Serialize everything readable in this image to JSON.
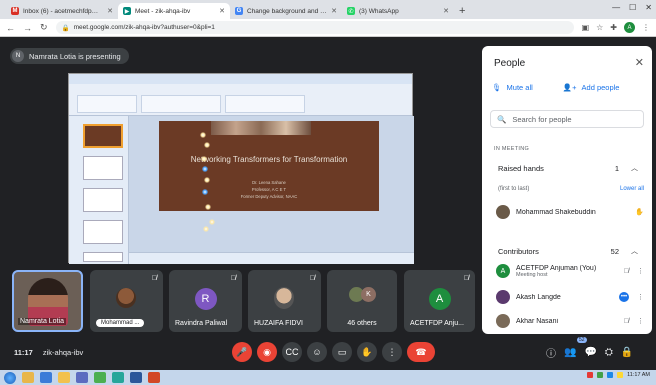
{
  "browser": {
    "tabs": [
      {
        "title": "Inbox (6) - acetmechfdp@gmail...",
        "fav": "M",
        "color": "#d93025",
        "active": false
      },
      {
        "title": "Meet - zik-ahqa-ibv",
        "fav": "▶",
        "color": "#00897b",
        "active": true
      },
      {
        "title": "Change background and apply vis...",
        "fav": "G",
        "color": "#4285f4",
        "active": false
      },
      {
        "title": "(3) WhatsApp",
        "fav": "✆",
        "color": "#25d366",
        "active": false
      }
    ],
    "url": "meet.google.com/zik-ahqa-ibv?authuser=0&pli=1",
    "profile_initial": "A"
  },
  "meet": {
    "presenter_banner": "Namrata Lotia is presenting",
    "presenter_initial": "N",
    "slide": {
      "title": "Networking Transformers for Transformation",
      "lines": [
        "Dr. Leena Sahane",
        "Professor, A C E T",
        "Former Deputy Advisor, NAAC"
      ]
    },
    "tiles": [
      {
        "name": "Namrata Lotia"
      },
      {
        "name": "Mohammad ..."
      },
      {
        "name": "Ravindra Paliwal",
        "initial": "R",
        "color": "#7e57c2"
      },
      {
        "name": "HUZAIFA FIDVI"
      },
      {
        "name": "46 others",
        "initial": "K",
        "color": "#8d6e63"
      },
      {
        "name": "ACETFDP Anju...",
        "initial": "A",
        "color": "#1e8e3e"
      }
    ],
    "time": "11:17",
    "meeting_code": "zik-ahqa-ibv",
    "participants_badge": "52"
  },
  "people": {
    "title": "People",
    "mute_all": "Mute all",
    "add_people": "Add people",
    "search_placeholder": "Search for people",
    "section_label": "IN MEETING",
    "raised_hands": {
      "label": "Raised hands",
      "count": "1",
      "order": "(first to last)",
      "lower_all": "Lower all"
    },
    "raised": [
      {
        "name": "Mohammad Shakebuddin"
      }
    ],
    "contributors": {
      "label": "Contributors",
      "count": "52"
    },
    "people_list": [
      {
        "name": "ACETFDP Anjuman (You)",
        "sub": "Meeting host",
        "initial": "A",
        "color": "#1e8e3e"
      },
      {
        "name": "Akash Langde",
        "sub": "",
        "initial": "",
        "color": "#5b3a6e"
      },
      {
        "name": "Akhar Nasani",
        "sub": "",
        "initial": "",
        "color": "#7a6a58"
      }
    ]
  },
  "taskbar": {
    "time": "11:17 AM"
  }
}
